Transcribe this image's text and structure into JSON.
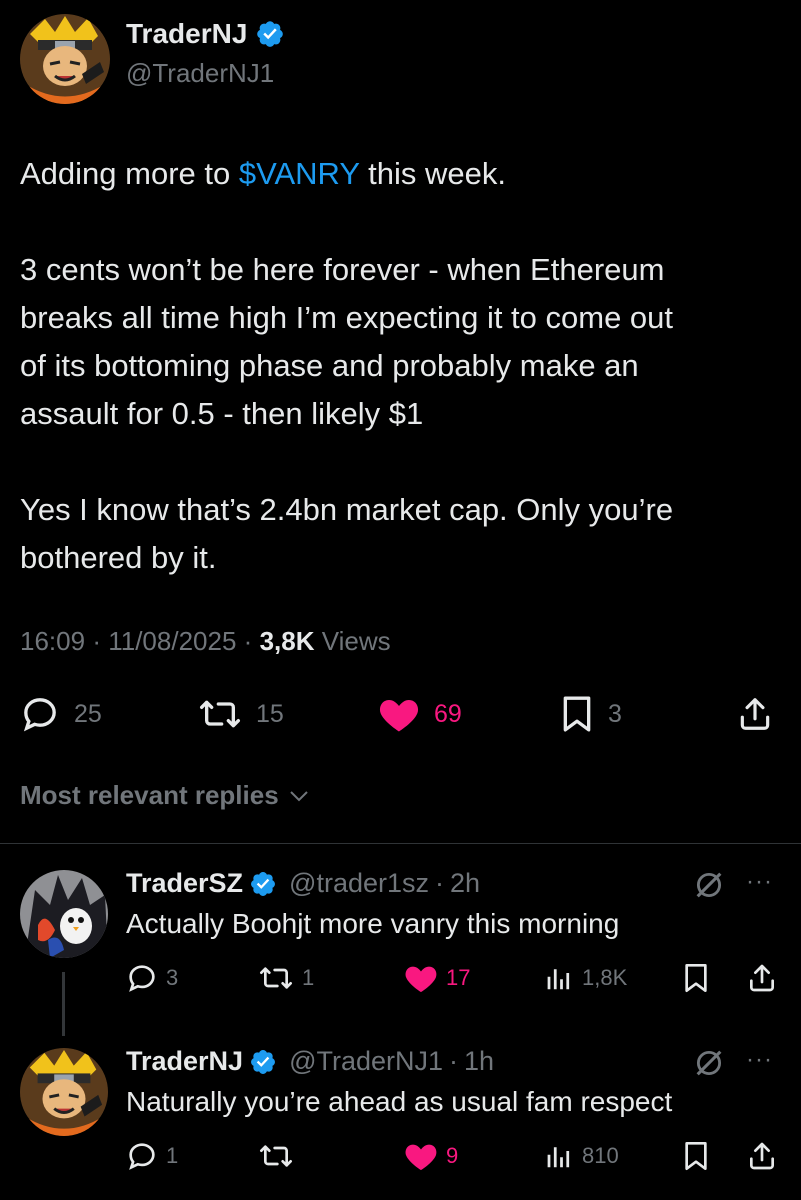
{
  "post": {
    "author_name": "TraderNJ",
    "author_handle": "@TraderNJ1",
    "text": {
      "line1_pre": "Adding more to ",
      "line1_cashtag": "$VANRY",
      "line1_post": " this week.",
      "para2": [
        "3 cents won’t be here forever - when Ethereum",
        "breaks all time high I’m expecting it to come out",
        "of its bottoming phase and probably make an",
        "assault for 0.5 - then likely $1"
      ],
      "para3": [
        "Yes I know that’s 2.4bn market cap. Only you’re",
        "bothered by it."
      ]
    },
    "time": "16:09",
    "sep1": "·",
    "date": "11/08/2025",
    "sep2": "·",
    "views": "3,8K",
    "views_label": "Views",
    "replies": "25",
    "reposts": "15",
    "likes": "69",
    "bookmarks": "3"
  },
  "sort": {
    "label": "Most relevant replies"
  },
  "replies": [
    {
      "author_name": "TraderSZ",
      "author_handle": "@trader1sz",
      "sep": "·",
      "time": "2h",
      "text": "Actually Boohjt more vanry this morning",
      "replies": "3",
      "reposts": "1",
      "likes": "17",
      "views": "1,8K",
      "more": "···"
    },
    {
      "author_name": "TraderNJ",
      "author_handle": "@TraderNJ1",
      "sep": "·",
      "time": "1h",
      "text": "Naturally you’re ahead as usual fam respect",
      "replies": "1",
      "reposts": "",
      "likes": "9",
      "views": "810",
      "more": "···"
    }
  ],
  "colors": {
    "background": "#000000",
    "text": "#e7e9ea",
    "secondary": "#71767b",
    "accent_blue": "#1d9bf0",
    "like_pink": "#f91880",
    "divider": "#2f3336"
  },
  "icons": [
    "verified-badge-icon",
    "reply-icon",
    "repost-icon",
    "heart-icon",
    "bookmark-icon",
    "share-icon",
    "chevron-down-icon",
    "grok-icon",
    "more-icon",
    "views-icon"
  ]
}
